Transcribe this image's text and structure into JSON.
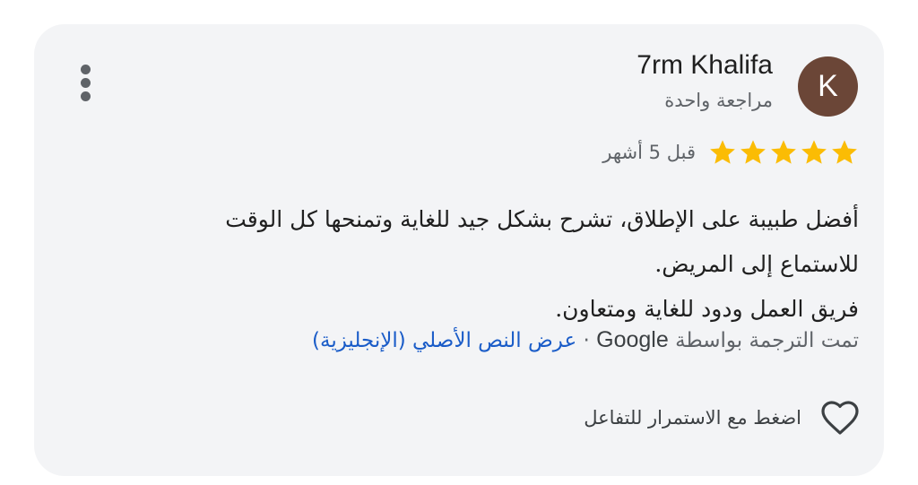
{
  "review": {
    "avatar_letter": "K",
    "reviewer_name": "7rm Khalifa",
    "reviews_count": "مراجعة واحدة",
    "rating": 5,
    "rating_max": 5,
    "time_ago": "قبل 5 أشهر",
    "text_lines": [
      "أفضل طبيبة على الإطلاق، تشرح بشكل جيد للغاية وتمنحها كل الوقت",
      "للاستماع إلى المريض.",
      "فريق العمل ودود للغاية ومتعاون."
    ],
    "translated_by": "تمت الترجمة بواسطة",
    "translator": "Google",
    "separator": "·",
    "show_original_link": "عرض النص الأصلي (الإنجليزية)",
    "like_label": "اضغط مع الاستمرار للتفاعل"
  },
  "icons": {
    "menu": "more-vert-icon",
    "star": "star-icon",
    "like": "heart-icon"
  },
  "colors": {
    "card_background": "#f3f4f6",
    "avatar_background": "#6b4637",
    "star": "#fbbc04",
    "link": "#1a5cc8",
    "secondary_text": "#5f6368"
  }
}
